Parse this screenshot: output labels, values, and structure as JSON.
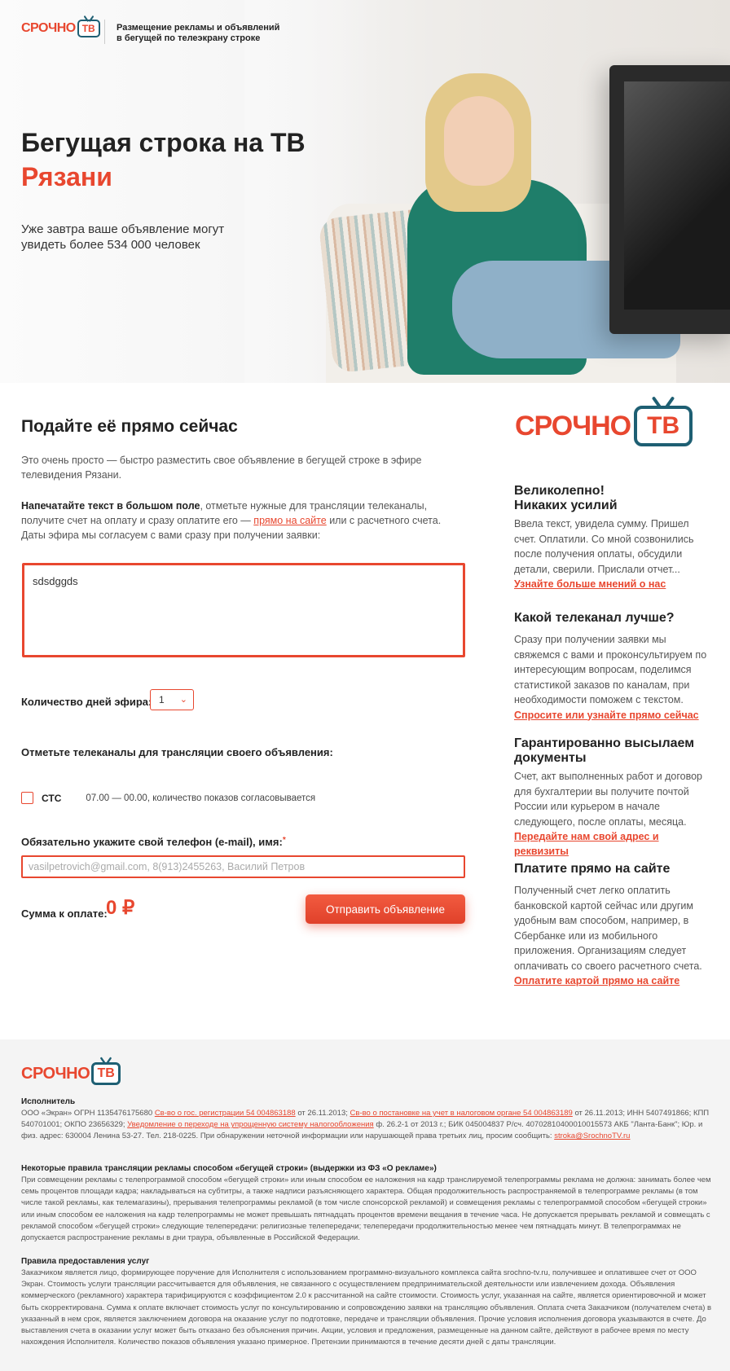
{
  "header": {
    "logo_word": "СРОЧНО",
    "logo_tv": "ТВ",
    "tagline_line1": "Размещение рекламы и объявлений",
    "tagline_line2": "в бегущей по телеэкрану строке"
  },
  "hero": {
    "title": "Бегущая строка на ТВ",
    "city": "Рязани",
    "subtitle": "Уже завтра ваше объявление могут увидеть более 534 000 человек"
  },
  "form": {
    "title": "Подайте её прямо сейчас",
    "intro": "Это очень просто — быстро разместить свое объявление в бегущей строке в эфире телевидения Рязани.",
    "instr_bold": "Напечатайте текст в большом поле",
    "instr_part1": ", отметьте нужные для трансляции телеканалы, получите счет на оплату и сразу оплатите его — ",
    "instr_link": "прямо на сайте",
    "instr_part2": " или с расчетного счета. Даты эфира мы согласуем с вами сразу при получении заявки:",
    "ad_text_value": "sdsdggds",
    "days_label": "Количество дней эфира:",
    "days_value": "1",
    "channels_label": "Отметьте телеканалы для трансляции своего объявления:",
    "channels": [
      {
        "name": "СТС",
        "time": "07.00 — 00.00, количество показов согласовывается",
        "checked": false
      }
    ],
    "phone_label": "Обязательно укажите свой телефон (e-mail), имя:",
    "phone_star": "*",
    "phone_placeholder": "vasilpetrovich@gmail.com, 8(913)2455263, Василий Петров",
    "sum_label": "Сумма к оплате:",
    "sum_value": "0 ₽",
    "send_label": "Отправить объявление"
  },
  "sidebar": {
    "logo_word": "СРОЧНО",
    "logo_tv": "ТВ",
    "blocks": [
      {
        "title_line1": "Великолепно!",
        "title_line2": "Никаких усилий",
        "text": "Ввела текст, увидела сумму. Пришел счет. Оплатили. Со мной созвонились после получения оплаты, обсудили детали, сверили. Прислали отчет...",
        "link": "Узнайте больше мнений о нас"
      },
      {
        "title_line1": "Какой телеканал лучше?",
        "title_line2": "",
        "text": "Сразу при получении заявки мы свяжемся с вами и проконсультируем по интересующим вопросам, поделимся статистикой заказов по каналам, при необходимости поможем с текстом.",
        "link": "Спросите или узнайте прямо сейчас"
      },
      {
        "title_line1": "Гарантированно высылаем",
        "title_line2": "документы",
        "text": "Счет, акт выполненных работ и договор для бухгалтерии вы получите почтой России или курьером в начале следующего, после оплаты, месяца.",
        "link": "Передайте нам свой адрес и реквизиты"
      },
      {
        "title_line1": "Платите прямо на сайте",
        "title_line2": "",
        "text": "Полученный счет легко оплатить банковской картой сейчас или другим удобным вам способом, например, в Сбербанке или из мобильного приложения. Организациям следует оплачивать со своего расчетного счета.",
        "link": "Оплатите картой прямо на сайте"
      }
    ]
  },
  "footer": {
    "logo_word": "СРОЧНО",
    "logo_tv": "ТВ",
    "executor_title": "Исполнитель",
    "executor_t1": "ООО «Экран» ОГРН 1135476175680 ",
    "executor_l1": "Св-во о гос. регистрации 54 004863188",
    "executor_t2": " от 26.11.2013; ",
    "executor_l2": "Св-во о постановке на учет в налоговом органе 54 004863189",
    "executor_t3": " от 26.11.2013; ИНН 5407491866; КПП 540701001; ОКПО 23656329; ",
    "executor_l3": "Уведомление о переходе на упрощенную систему налогообложения",
    "executor_t4": " ф. 26.2-1 от 2013 г.; БИК 045004837 Р/сч. 40702810400010015573 АКБ \"Ланта-Банк\"; Юр. и физ. адрес: 630004 Ленина 53-27. Тел. 218-0225. При обнаружении неточной информации или нарушающей права третьих лиц, просим сообщить: ",
    "executor_email": "stroka@SrochnoTV.ru",
    "rules_title": "Некоторые правила трансляции рекламы способом «бегущей строки» (выдержки из ФЗ «О рекламе»)",
    "rules_text": "При совмещении рекламы с телепрограммой способом «бегущей строки» или иным способом ее наложения на кадр транслируемой телепрограммы реклама не должна: занимать более чем семь процентов площади кадра; накладываться на субтитры, а также надписи разъясняющего характера. Общая продолжительность распространяемой в телепрограмме рекламы (в том числе такой рекламы, как телемагазины), прерывания телепрограммы рекламой (в том числе спонсорской рекламой) и совмещения рекламы с телепрограммой способом «бегущей строки» или иным способом ее наложения на кадр телепрограммы не может превышать пятнадцать процентов времени вещания в течение часа. Не допускается прерывать рекламой и совмещать с рекламой способом «бегущей строки» следующие телепередачи: религиозные телепередачи; телепередачи продолжительностью менее чем пятнадцать минут. В телепрограммах не допускается распространение рекламы в дни траура, объявленные в Российской Федерации.",
    "terms_title": "Правила предоставления услуг",
    "terms_text": "Заказчиком является лицо, формирующее поручение для Исполнителя с использованием программно-визуального комплекса сайта srochno-tv.ru, получившее и оплатившее счет от ООО Экран. Стоимость услуги трансляции рассчитывается для объявления, не связанного с осуществлением предпринимательской деятельности или извлечением дохода. Объявления коммерческого (рекламного) характера тарифицируются с коэффициентом 2.0 к рассчитанной на сайте стоимости. Стоимость услуг, указанная на сайте, является ориентировочной и может быть скорректирована. Сумма к оплате включает стоимость услуг по консультированию и сопровождению заявки на трансляцию объявления. Оплата счета Заказчиком (получателем счета) в указанный в нем срок, является заключением договора на оказание услуг по подготовке, передаче и трансляции объявления. Прочие условия исполнения договора указываются в счете. До выставления счета в оказании услуг может быть отказано без объяснения причин. Акции, условия и предложения, размещенные на данном сайте, действуют в рабочее время по месту нахождения Исполнителя. Количество показов объявления указано примерное. Претензии принимаются в течение десяти дней с даты трансляции."
  },
  "colors": {
    "accent": "#e8472f",
    "logo_tv_border": "#1e5f73",
    "footer_bg": "#f4f4f4"
  }
}
